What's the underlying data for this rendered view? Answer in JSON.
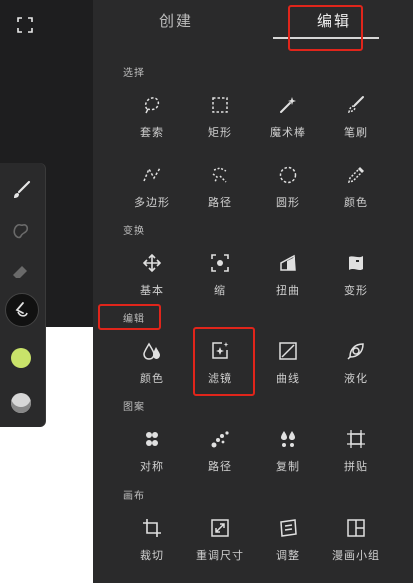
{
  "tabs": {
    "create": "创建",
    "edit": "编辑"
  },
  "sections": {
    "select": "选择",
    "transform": "变换",
    "edit": "编辑",
    "pattern": "图案",
    "canvas": "画布"
  },
  "select_tools": [
    "套索",
    "矩形",
    "魔术棒",
    "笔刷",
    "多边形",
    "路径",
    "圆形",
    "颜色"
  ],
  "transform_tools": [
    "基本",
    "缩",
    "扭曲",
    "变形"
  ],
  "edit_tools": [
    "颜色",
    "滤镜",
    "曲线",
    "液化"
  ],
  "pattern_tools": [
    "对称",
    "路径",
    "复制",
    "拼贴"
  ],
  "canvas_tools": [
    "裁切",
    "重调尺寸",
    "调整",
    "漫画小组"
  ],
  "colors": {
    "accent": "#c9e36a",
    "highlight": "#e0251b",
    "panel": "#2a2a2b"
  }
}
